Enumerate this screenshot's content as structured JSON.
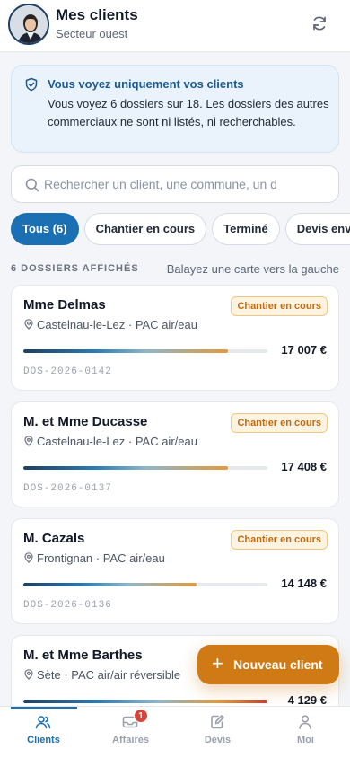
{
  "header": {
    "title": "Mes clients",
    "subtitle": "Secteur ouest"
  },
  "notice": {
    "title": "Vous voyez uniquement vos clients",
    "body": "Vous voyez 6 dossiers sur 18. Les dossiers des autres commerciaux ne sont ni listés, ni recherchables."
  },
  "search": {
    "placeholder": "Rechercher un client, une commune, un d"
  },
  "filters": [
    {
      "label": "Tous (6)",
      "active": true
    },
    {
      "label": "Chantier en cours",
      "active": false
    },
    {
      "label": "Terminé",
      "active": false
    },
    {
      "label": "Devis envoyé",
      "active": false
    }
  ],
  "list": {
    "count_label": "6 DOSSIERS AFFICHÉS",
    "hint": "Balayez une carte vers la gauche"
  },
  "cards": [
    {
      "name": "Mme Delmas",
      "status": "Chantier en cours",
      "location": "Castelnau-le-Lez · PAC air/eau",
      "progress": 0.84,
      "amount": "17 007 €",
      "ref": "DOS-2026-0142"
    },
    {
      "name": "M. et Mme Ducasse",
      "status": "Chantier en cours",
      "location": "Castelnau-le-Lez · PAC air/eau",
      "progress": 0.84,
      "amount": "17 408 €",
      "ref": "DOS-2026-0137"
    },
    {
      "name": "M. Cazals",
      "status": "Chantier en cours",
      "location": "Frontignan · PAC air/eau",
      "progress": 0.71,
      "amount": "14 148 €",
      "ref": "DOS-2026-0136"
    },
    {
      "name": "M. et Mme Barthes",
      "status": "",
      "location": "Sète · PAC air/air réversible",
      "progress": 1.0,
      "amount": "4 129 €",
      "ref": ""
    }
  ],
  "fab": {
    "label": "Nouveau client"
  },
  "tabs": [
    {
      "label": "Clients",
      "icon": "users-icon",
      "active": true
    },
    {
      "label": "Affaires",
      "icon": "inbox-icon",
      "badge": "1"
    },
    {
      "label": "Devis",
      "icon": "edit-document-icon"
    },
    {
      "label": "Moi",
      "icon": "person-icon"
    }
  ],
  "colors": {
    "primary": "#1b6fb3",
    "accent": "#cf7a14",
    "badge": "#d7443e"
  }
}
